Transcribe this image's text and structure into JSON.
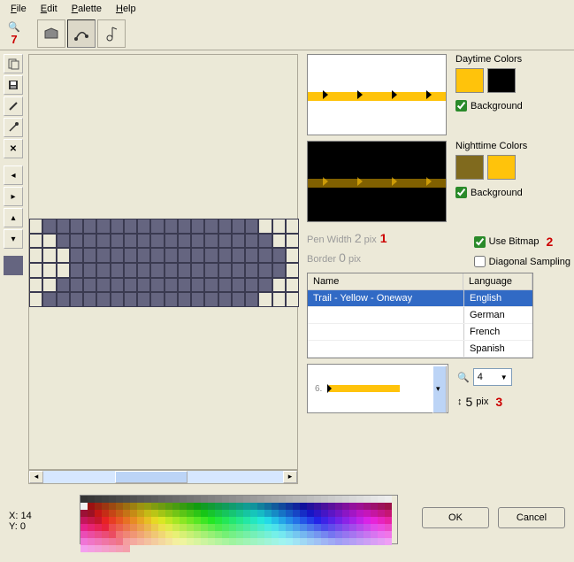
{
  "menu": {
    "file": "File",
    "edit": "Edit",
    "palette": "Palette",
    "help": "Help"
  },
  "zoom_level": "7",
  "annotations": {
    "one": "1",
    "two": "2",
    "three": "3"
  },
  "params": {
    "pen_label": "Pen Width",
    "pen_val": "2",
    "pen_unit": "pix",
    "border_label": "Border",
    "border_val": "0",
    "border_unit": "pix"
  },
  "checks": {
    "use_bitmap": "Use Bitmap",
    "diag_sampling": "Diagonal Sampling",
    "background": "Background"
  },
  "colors": {
    "day_title": "Daytime Colors",
    "night_title": "Nighttime Colors",
    "day1": "#ffc30b",
    "day2": "#000000",
    "night1": "#806a1e",
    "night2": "#ffc30b"
  },
  "table": {
    "hdr_name": "Name",
    "hdr_lang": "Language",
    "rows": [
      {
        "name": "Trail - Yellow - Oneway",
        "lang": "English",
        "sel": true
      },
      {
        "name": "",
        "lang": "German",
        "sel": false
      },
      {
        "name": "",
        "lang": "French",
        "sel": false
      },
      {
        "name": "",
        "lang": "Spanish",
        "sel": false
      }
    ]
  },
  "mini": {
    "index": "6."
  },
  "zoom_select": "4",
  "height": {
    "val": "5",
    "unit": "pix"
  },
  "coords": {
    "x_label": "X:",
    "x": "14",
    "y_label": "Y:",
    "y": "0"
  },
  "buttons": {
    "ok": "OK",
    "cancel": "Cancel"
  }
}
